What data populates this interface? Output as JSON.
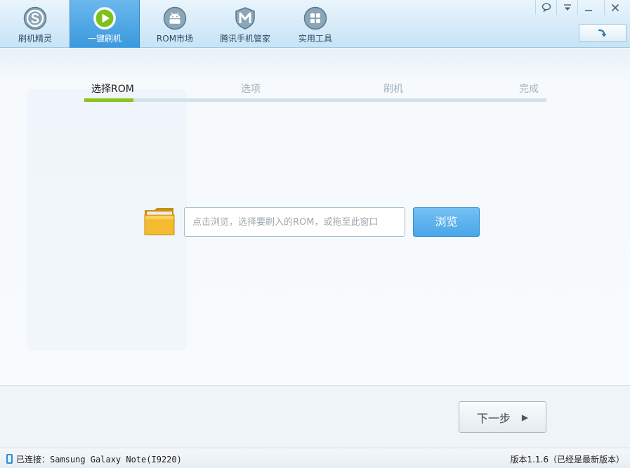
{
  "nav": {
    "tabs": [
      {
        "label": "刷机精灵",
        "icon": "shuaji-logo-icon"
      },
      {
        "label": "一键刷机",
        "icon": "play-icon"
      },
      {
        "label": "ROM市场",
        "icon": "android-icon"
      },
      {
        "label": "腾讯手机管家",
        "icon": "tencent-shield-icon"
      },
      {
        "label": "实用工具",
        "icon": "grid-tools-icon"
      }
    ],
    "active_index": 1
  },
  "window_controls": [
    "feedback-icon",
    "menu-icon",
    "minimize-icon",
    "close-icon"
  ],
  "steps": {
    "items": [
      "选择ROM",
      "选项",
      "刷机",
      "完成"
    ],
    "active_index": 0,
    "progress_fraction": 0.106
  },
  "rom_picker": {
    "value": "",
    "placeholder": "点击浏览，选择要刷入的ROM，或拖至此窗口",
    "browse_label": "浏览"
  },
  "next_button": {
    "label": "下一步",
    "arrow": "▶"
  },
  "status": {
    "connection_text": "已连接：Samsung Galaxy Note(I9220)",
    "version_text": "版本1.1.6（已经是最新版本）"
  },
  "colors": {
    "accent_blue": "#3b99dc",
    "progress_green": "#8dc21f"
  }
}
